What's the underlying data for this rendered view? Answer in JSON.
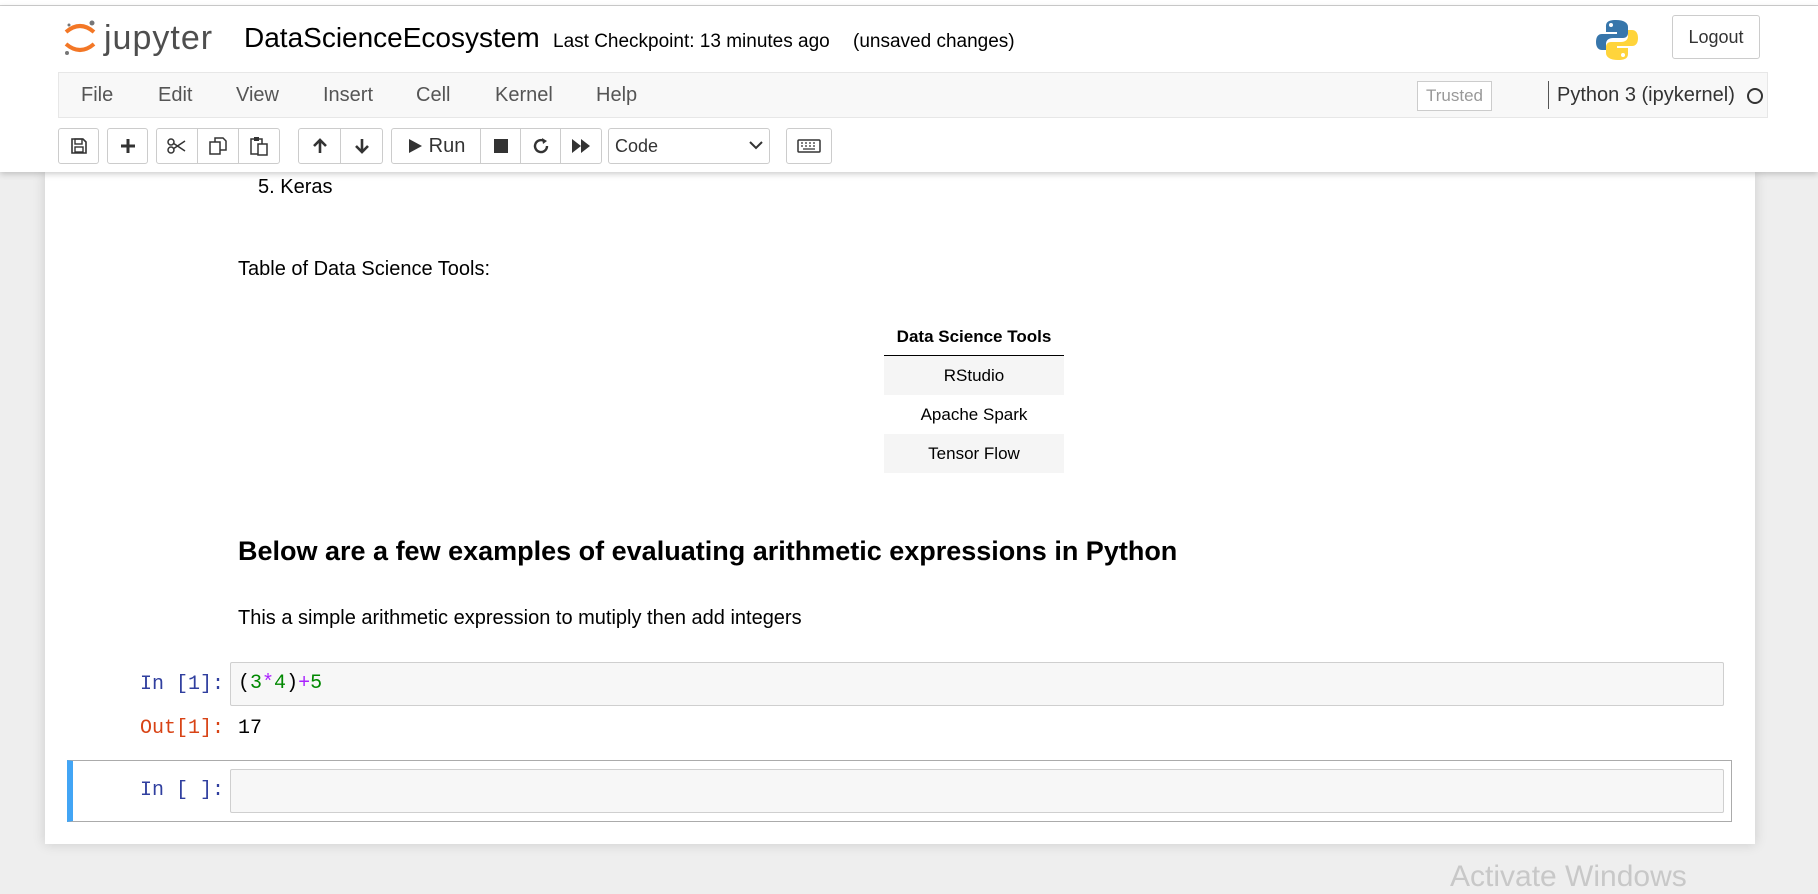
{
  "header": {
    "logo_text": "jupyter",
    "notebook_title": "DataScienceEcosystem",
    "checkpoint": "Last Checkpoint: 13 minutes ago",
    "unsaved": "(unsaved changes)",
    "logout_label": "Logout"
  },
  "menu": {
    "items": [
      "File",
      "Edit",
      "View",
      "Insert",
      "Cell",
      "Kernel",
      "Help"
    ],
    "trusted": "Trusted",
    "kernel": "Python 3 (ipykernel)"
  },
  "toolbar": {
    "run_label": "Run",
    "cell_type": "Code"
  },
  "notebook": {
    "list_item": "5. Keras",
    "table_caption": "Table of Data Science Tools:",
    "table": {
      "header": "Data Science Tools",
      "rows": [
        "RStudio",
        "Apache Spark",
        "Tensor Flow"
      ]
    },
    "heading": "Below are a few examples of evaluating arithmetic expressions in Python",
    "paragraph": "This a simple arithmetic expression to mutiply then add integers",
    "cell1": {
      "in_prompt": "In [1]:",
      "code_tokens": [
        "(",
        "3",
        "*",
        "4",
        ")",
        "+",
        "5"
      ],
      "out_prompt": "Out[1]:",
      "output": "17"
    },
    "cell2": {
      "in_prompt": "In [ ]:"
    }
  },
  "watermark": "Activate Windows",
  "colors": {
    "in_prompt": "#303f9f",
    "out_prompt": "#d84315",
    "selected_cell_border": "#42a5f5",
    "jupyter_orange": "#f37726"
  }
}
